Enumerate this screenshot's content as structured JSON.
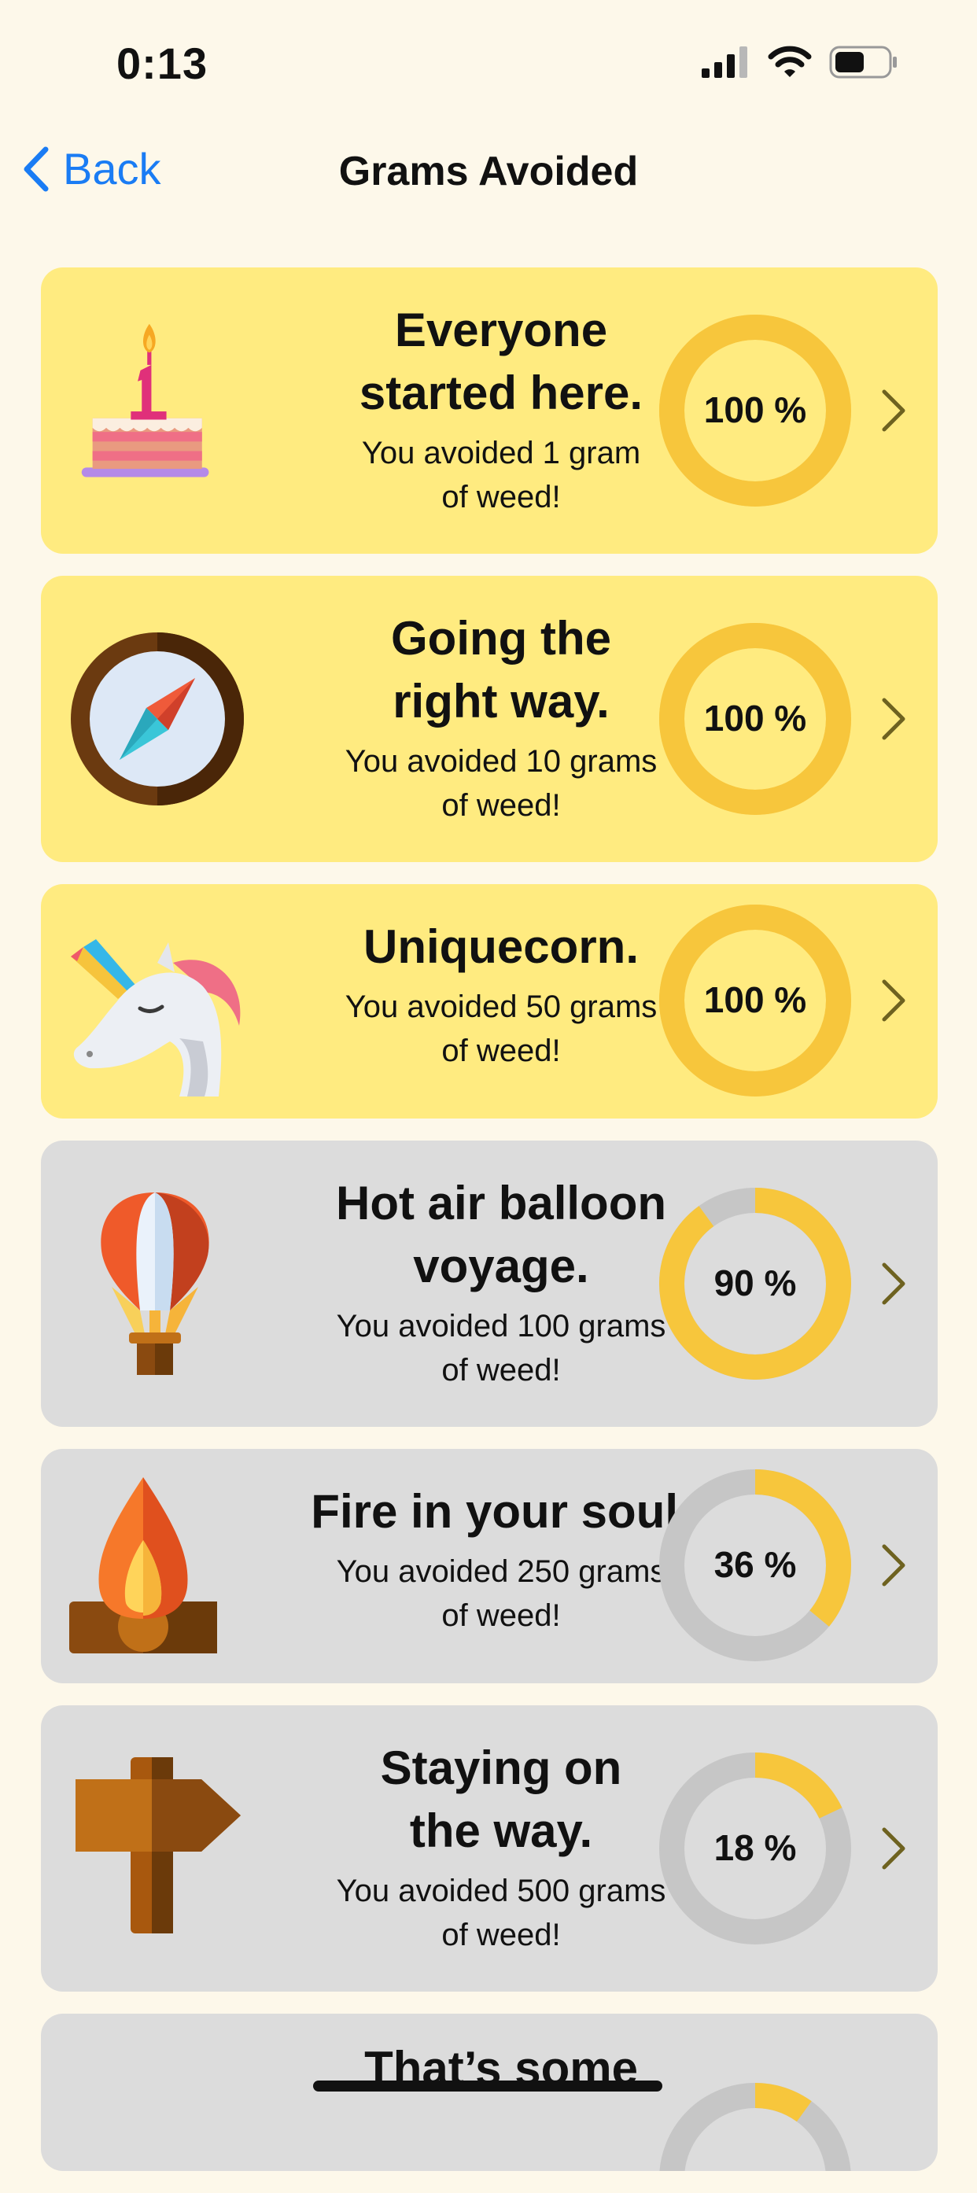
{
  "status_bar": {
    "time": "0:13"
  },
  "nav": {
    "back_label": "Back",
    "title": "Grams Avoided"
  },
  "colors": {
    "accent_blue": "#1a7cf4",
    "card_complete": "#ffeb80",
    "card_incomplete": "#dcdcdc",
    "ring_progress": "#f7c63c",
    "ring_track_complete": "#fcd45a",
    "ring_track_incomplete": "#c6c6c6"
  },
  "achievements": [
    {
      "icon": "birthday-cake-icon",
      "title_lines": [
        "Everyone",
        "started here."
      ],
      "subtitle_lines": [
        "You avoided 1 gram",
        "of weed!"
      ],
      "progress_label": "100 %",
      "progress": 1.0,
      "completed": true
    },
    {
      "icon": "compass-icon",
      "title_lines": [
        "Going the",
        "right way."
      ],
      "subtitle_lines": [
        "You avoided 10 grams",
        "of weed!"
      ],
      "progress_label": "100 %",
      "progress": 1.0,
      "completed": true
    },
    {
      "icon": "unicorn-icon",
      "title_lines": [
        "Uniquecorn."
      ],
      "subtitle_lines": [
        "You avoided 50 grams",
        "of weed!"
      ],
      "progress_label": "100 %",
      "progress": 1.0,
      "completed": true
    },
    {
      "icon": "hot-air-balloon-icon",
      "title_lines": [
        "Hot air balloon",
        "voyage."
      ],
      "subtitle_lines": [
        "You avoided 100 grams",
        "of weed!"
      ],
      "progress_label": "90 %",
      "progress": 0.9,
      "completed": false
    },
    {
      "icon": "campfire-icon",
      "title_lines": [
        "Fire in your soul."
      ],
      "subtitle_lines": [
        "You avoided 250 grams",
        "of weed!"
      ],
      "progress_label": "36 %",
      "progress": 0.36,
      "completed": false
    },
    {
      "icon": "signpost-icon",
      "title_lines": [
        "Staying on",
        "the way."
      ],
      "subtitle_lines": [
        "You avoided 500 grams",
        "of weed!"
      ],
      "progress_label": "18 %",
      "progress": 0.18,
      "completed": false
    },
    {
      "icon": "unknown-icon",
      "title_lines": [
        "That’s some"
      ],
      "subtitle_lines": [],
      "progress_label": "",
      "progress": 0.1,
      "completed": false
    }
  ]
}
